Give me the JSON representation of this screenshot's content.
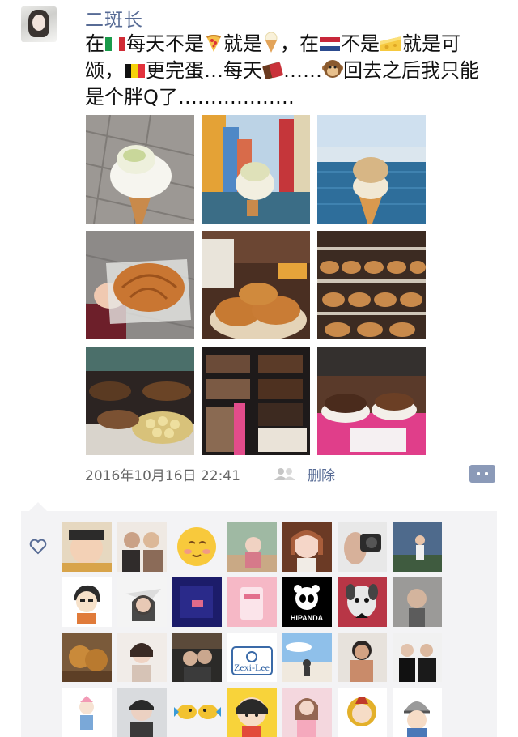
{
  "post": {
    "username": "二斑长",
    "text_parts": {
      "p1": "在",
      "p2": "每天不是",
      "p3": "就是",
      "p4": "，在",
      "p5": "不是",
      "p6": "就是可颂，",
      "p7": "更完蛋…每天",
      "p8": "……",
      "p9": "回去之后我只能是个胖Q了………………"
    },
    "timestamp": "2016年10月16日 22:41",
    "delete_label": "删除"
  },
  "likes": {
    "avatar_labels": {
      "zexi": "Zexi-Lee",
      "hipanda": "HIPANDA"
    }
  },
  "colors": {
    "name_link": "#576b95",
    "likes_bg": "#f3f3f5",
    "comment_button": "#8b9ab8"
  },
  "icons": [
    "heart-icon",
    "people-icon",
    "comment-icon"
  ]
}
